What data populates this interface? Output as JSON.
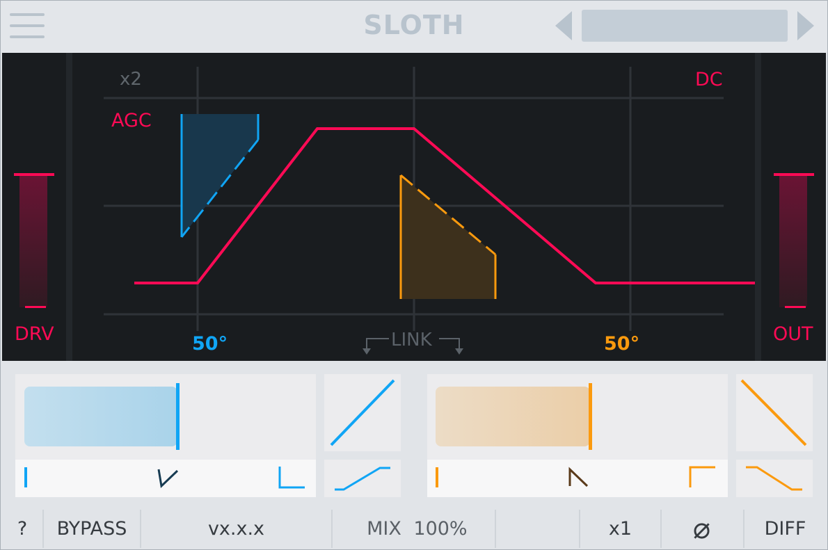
{
  "header": {
    "title": "SLOTH",
    "preset_name": ""
  },
  "graph": {
    "oversample_label": "x2",
    "agc_label": "AGC",
    "dc_label": "DC",
    "angle_left": "50°",
    "angle_right": "50°",
    "link_label": "LINK",
    "drive_label": "DRV",
    "output_label": "OUT"
  },
  "footer": {
    "help_label": "?",
    "bypass_label": "BYPASS",
    "version_label": "vx.x.x",
    "mix_label": "MIX",
    "mix_value": "100%",
    "oversample_value": "x1",
    "phase_icon": "⌀",
    "diff_label": "DIFF"
  },
  "colors": {
    "accent_pink": "#ff0a55",
    "blue": "#10a5f5",
    "orange": "#fb9a0e",
    "background_dark": "#191c1f"
  }
}
